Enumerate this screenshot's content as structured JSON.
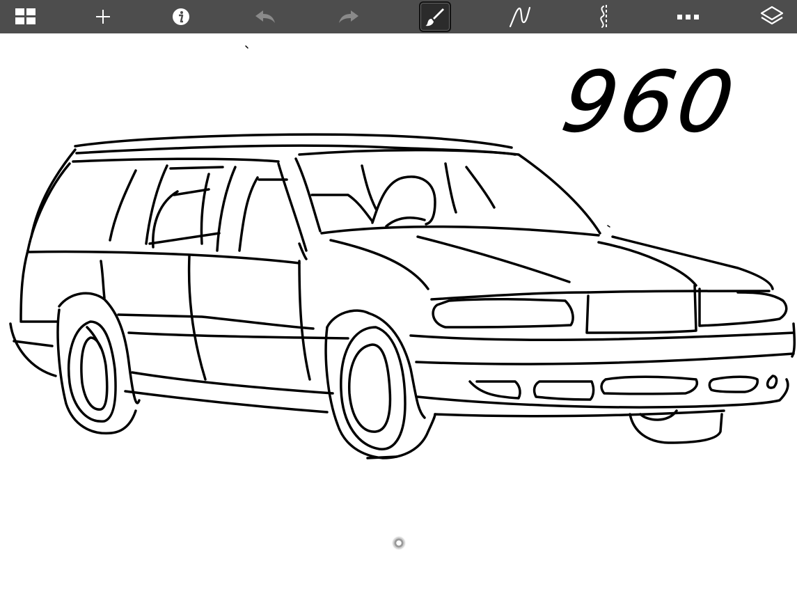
{
  "toolbar": {
    "background": "#4d4d4d",
    "icon_color": "#ffffff",
    "disabled_icon_color": "#8a8a8a",
    "buttons": [
      {
        "name": "gallery",
        "icon": "grid-icon"
      },
      {
        "name": "new",
        "icon": "plus-icon"
      },
      {
        "name": "info",
        "icon": "info-icon"
      },
      {
        "name": "undo",
        "icon": "undo-icon",
        "enabled": false
      },
      {
        "name": "redo",
        "icon": "redo-icon",
        "enabled": false
      },
      {
        "name": "brush",
        "icon": "brush-icon",
        "selected": true
      },
      {
        "name": "stroke",
        "icon": "stroke-curve-icon"
      },
      {
        "name": "symmetry",
        "icon": "symmetry-icon"
      },
      {
        "name": "more",
        "icon": "ellipsis-icon"
      },
      {
        "name": "layers",
        "icon": "layers-icon"
      }
    ]
  },
  "canvas": {
    "background": "#ffffff",
    "ink_color": "#000000",
    "drawn_text": "960"
  }
}
